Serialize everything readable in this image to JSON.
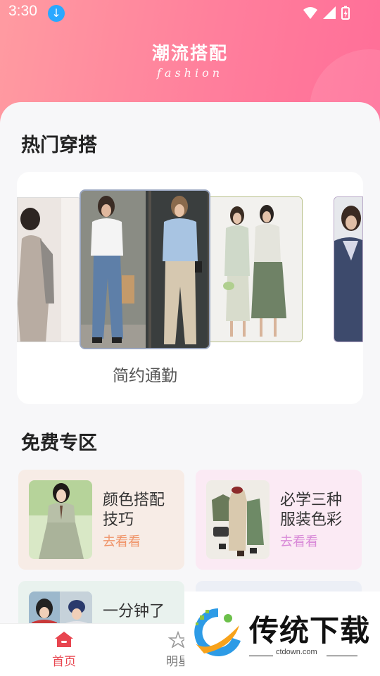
{
  "status_bar": {
    "time": "3:30"
  },
  "header": {
    "title": "潮流搭配",
    "subtitle": "fashion"
  },
  "hot_section": {
    "title": "热门穿搭",
    "caption": "简约通勤"
  },
  "free_section": {
    "title": "免费专区",
    "cards": [
      {
        "title_line1": "颜色搭配",
        "title_line2": "技巧",
        "link": "去看看",
        "bg": "#f7ece6",
        "link_color": "#f0956a"
      },
      {
        "title_line1": "必学三种",
        "title_line2": "服装色彩",
        "link": "去看看",
        "bg": "#fbeaf4",
        "link_color": "#d98ad8"
      },
      {
        "title_line1": "一分钟了",
        "title_line2": "",
        "link": "",
        "bg": "#e9f2ee",
        "link_color": "#7ab59a"
      },
      {
        "title_line1": "",
        "title_line2": "",
        "link": "",
        "bg": "#eceff6",
        "link_color": "#8899cc"
      }
    ]
  },
  "tab_bar": {
    "tabs": [
      {
        "label": "首页",
        "active": true
      },
      {
        "label": "明星"
      }
    ],
    "active_color": "#e8454f"
  },
  "watermark": {
    "brand": "传统下载",
    "url": "ctdown.com"
  }
}
